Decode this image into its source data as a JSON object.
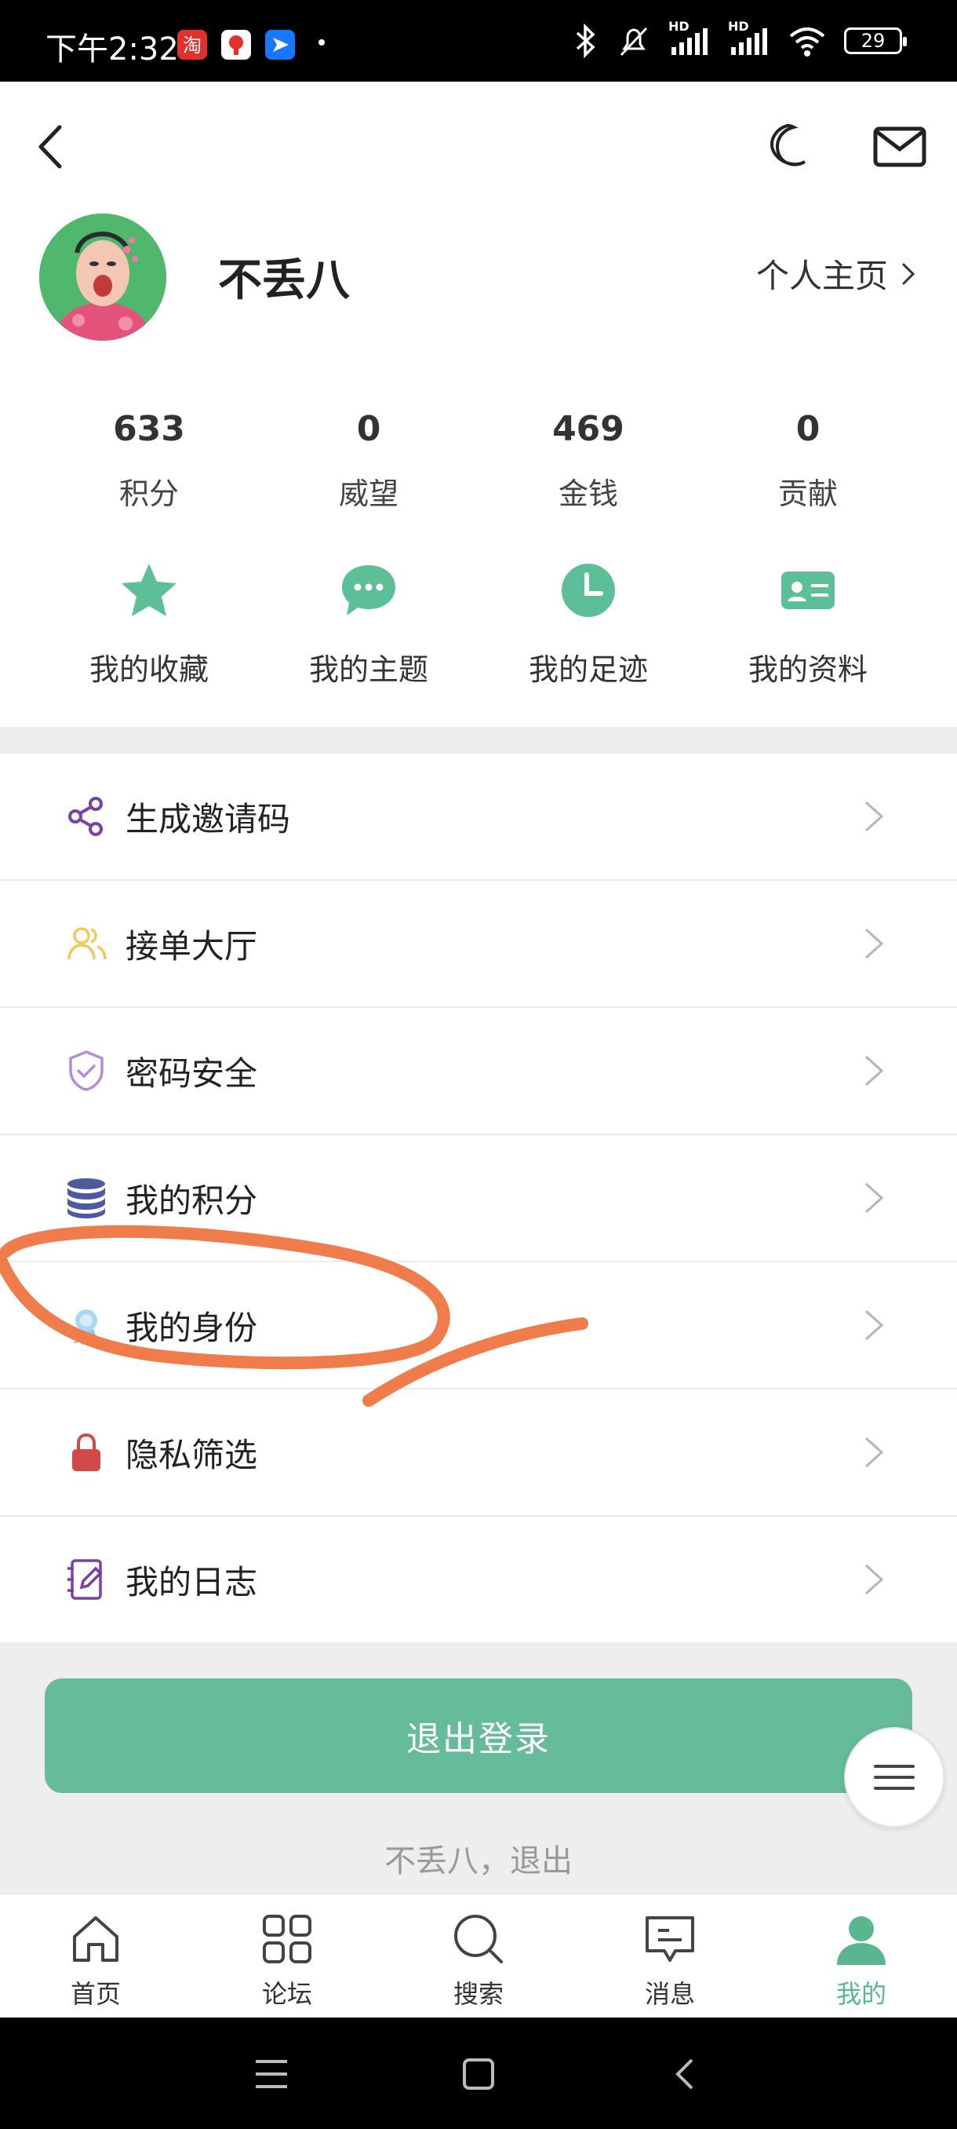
{
  "status_bar": {
    "time": "下午2:32",
    "signal_labels": [
      "HD",
      "HD"
    ],
    "battery": "29"
  },
  "header": {
    "back_icon": "back-chevron-icon",
    "night_icon": "moon-icon",
    "mail_icon": "mail-icon"
  },
  "profile": {
    "username": "不丢八",
    "homepage_label": "个人主页"
  },
  "stats": [
    {
      "value": "633",
      "label": "积分"
    },
    {
      "value": "0",
      "label": "威望"
    },
    {
      "value": "469",
      "label": "金钱"
    },
    {
      "value": "0",
      "label": "贡献"
    }
  ],
  "quick_links": [
    {
      "label": "我的收藏",
      "icon": "star-icon"
    },
    {
      "label": "我的主题",
      "icon": "chat-bubble-icon"
    },
    {
      "label": "我的足迹",
      "icon": "clock-icon"
    },
    {
      "label": "我的资料",
      "icon": "id-card-icon"
    }
  ],
  "menu": [
    {
      "label": "生成邀请码",
      "icon": "share-icon"
    },
    {
      "label": "接单大厅",
      "icon": "users-icon"
    },
    {
      "label": "密码安全",
      "icon": "shield-icon"
    },
    {
      "label": "我的积分",
      "icon": "database-icon"
    },
    {
      "label": "我的身份",
      "icon": "badge-icon"
    },
    {
      "label": "隐私筛选",
      "icon": "lock-icon"
    },
    {
      "label": "我的日志",
      "icon": "notebook-icon"
    }
  ],
  "logout": {
    "button_label": "退出登录",
    "note": "不丢八，退出"
  },
  "bottom_nav": [
    {
      "label": "首页",
      "icon": "home-icon"
    },
    {
      "label": "论坛",
      "icon": "grid-icon"
    },
    {
      "label": "搜索",
      "icon": "search-icon"
    },
    {
      "label": "消息",
      "icon": "message-icon"
    },
    {
      "label": "我的",
      "icon": "user-icon",
      "active": true
    }
  ],
  "colors": {
    "accent": "#66bb9b",
    "active_nav": "#59b78f",
    "annotation_stroke": "#f07b4b"
  }
}
